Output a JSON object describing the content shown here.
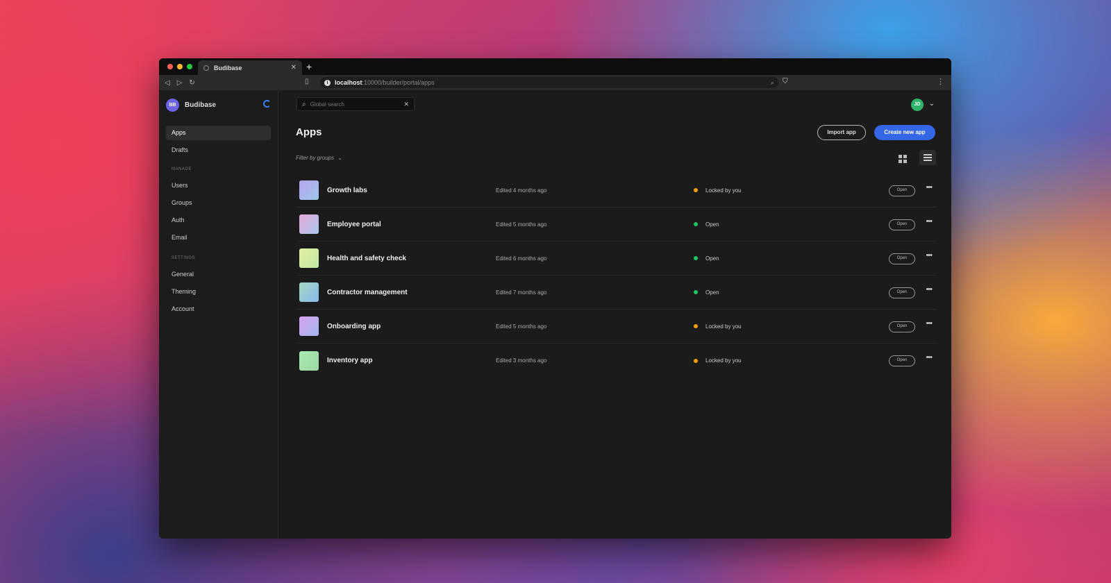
{
  "browser": {
    "tab_title": "Budibase",
    "url_host": "localhost",
    "url_path": ":10000/builder/portal/apps"
  },
  "sidebar": {
    "brand_initials": "BB",
    "brand_name": "Budibase",
    "top_items": [
      {
        "label": "Apps",
        "active": true
      },
      {
        "label": "Drafts",
        "active": false
      }
    ],
    "sections": [
      {
        "title": "MANAGE",
        "items": [
          "Users",
          "Groups",
          "Auth",
          "Email"
        ]
      },
      {
        "title": "SETTINGS",
        "items": [
          "General",
          "Theming",
          "Account"
        ]
      }
    ]
  },
  "header": {
    "search_placeholder": "Global search",
    "user_initials": "JD"
  },
  "main": {
    "title": "Apps",
    "import_label": "Import app",
    "create_label": "Create new app",
    "filter_label": "Filter by groups",
    "open_label": "Open",
    "apps": [
      {
        "name": "Growth labs",
        "edited": "Edited 4 months ago",
        "status": "Locked by you",
        "status_color": "#f59e0b",
        "thumb": [
          "#b7a3f0",
          "#9cc8e8"
        ]
      },
      {
        "name": "Employee portal",
        "edited": "Edited 5 months ago",
        "status": "Open",
        "status_color": "#22c55e",
        "thumb": [
          "#e7a6d8",
          "#a8c7ee"
        ]
      },
      {
        "name": "Health and safety check",
        "edited": "Edited 6 months ago",
        "status": "Open",
        "status_color": "#22c55e",
        "thumb": [
          "#e2eea0",
          "#c0e6a4"
        ]
      },
      {
        "name": "Contractor management",
        "edited": "Edited 7 months ago",
        "status": "Open",
        "status_color": "#22c55e",
        "thumb": [
          "#a0d8c0",
          "#8ab8ec"
        ]
      },
      {
        "name": "Onboarding app",
        "edited": "Edited 5 months ago",
        "status": "Locked by you",
        "status_color": "#f59e0b",
        "thumb": [
          "#d7a0ee",
          "#a4b8f0"
        ]
      },
      {
        "name": "Inventory app",
        "edited": "Edited 3 months ago",
        "status": "Locked by you",
        "status_color": "#f59e0b",
        "thumb": [
          "#a6ecb0",
          "#9ed6a4"
        ]
      }
    ]
  }
}
